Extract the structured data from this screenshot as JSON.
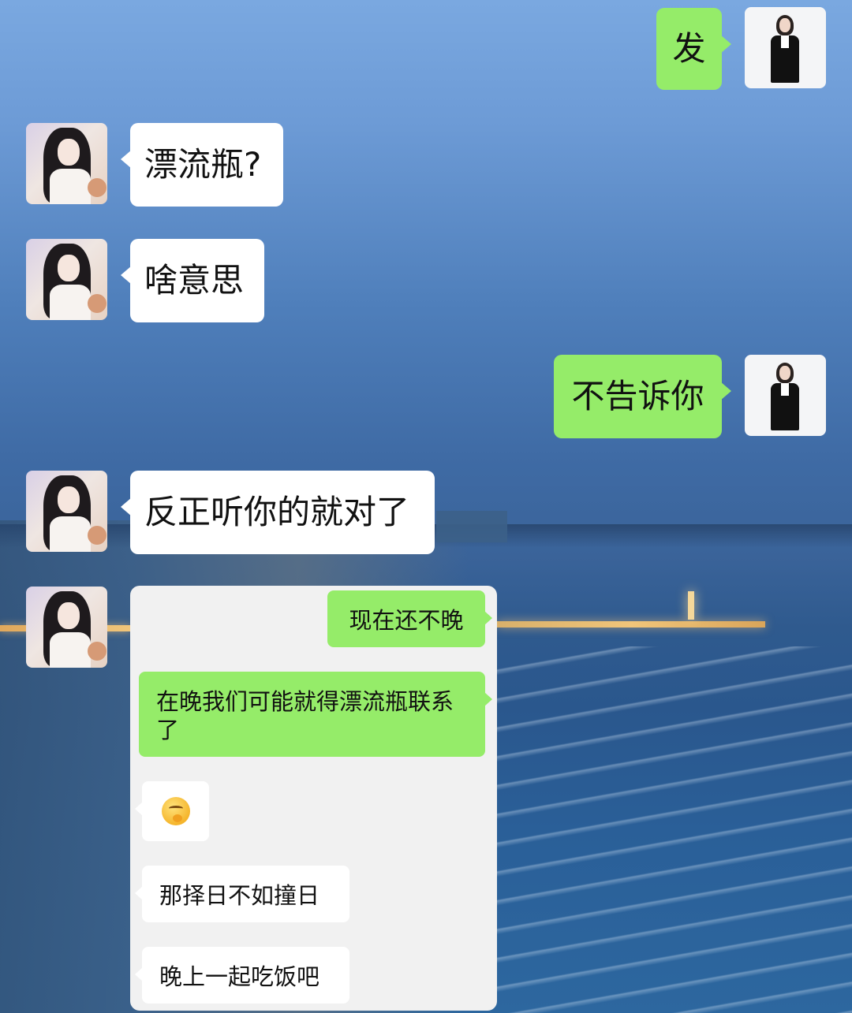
{
  "messages": [
    {
      "side": "right",
      "text": "发"
    },
    {
      "side": "left",
      "text": "漂流瓶?"
    },
    {
      "side": "left",
      "text": "啥意思"
    },
    {
      "side": "right",
      "text": "不告诉你"
    },
    {
      "side": "left",
      "text": "反正听你的就对了"
    }
  ],
  "forwarded": {
    "items": [
      {
        "side": "right",
        "text": "现在还不晚"
      },
      {
        "side": "right",
        "text": "在晚我们可能就得漂流瓶联系了"
      },
      {
        "side": "left",
        "emoji": "thinking-face-emoji"
      },
      {
        "side": "left",
        "text": "那择日不如撞日"
      },
      {
        "side": "left",
        "text": "晚上一起吃饭吧"
      }
    ]
  },
  "colors": {
    "sent_bubble": "#95ec69",
    "received_bubble": "#ffffff",
    "forwarded_card": "#f1f1f1"
  },
  "icons": {
    "contact_avatar": "girl-portrait-avatar",
    "self_avatar": "businesswoman-avatar"
  }
}
